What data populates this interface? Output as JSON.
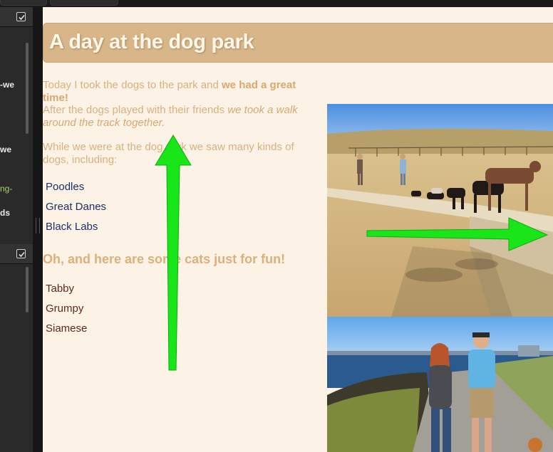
{
  "sidebar": {
    "fragments": [
      "-we",
      "we",
      "ng-",
      "ds"
    ]
  },
  "article": {
    "title": "A day at the dog park",
    "intro_plain": "Today I took the dogs to the park and ",
    "intro_bold": "we had a great time!",
    "walk_plain": "After the dogs played with their friends ",
    "walk_italic": "we took a walk around the track together.",
    "breeds_intro": "While we were at the dog park we saw many kinds of dogs, including:",
    "dog_breeds": [
      "Poodles",
      "Great Danes",
      "Black Labs"
    ],
    "cats_heading": "Oh, and here are some cats just for fun!",
    "cat_names": [
      "Tabby",
      "Grumpy",
      "Siamese"
    ]
  },
  "photos": [
    "dog-park-photo",
    "walking-couple-photo"
  ],
  "annotations": {
    "arrow_color": "#19e619"
  },
  "colors": {
    "page_bg": "#fcf3e6",
    "title_bar": "#d8b689",
    "body_text": "#d9b07e",
    "dog_list_text": "#1c2f6b",
    "cat_list_text": "#5a2a1e"
  }
}
